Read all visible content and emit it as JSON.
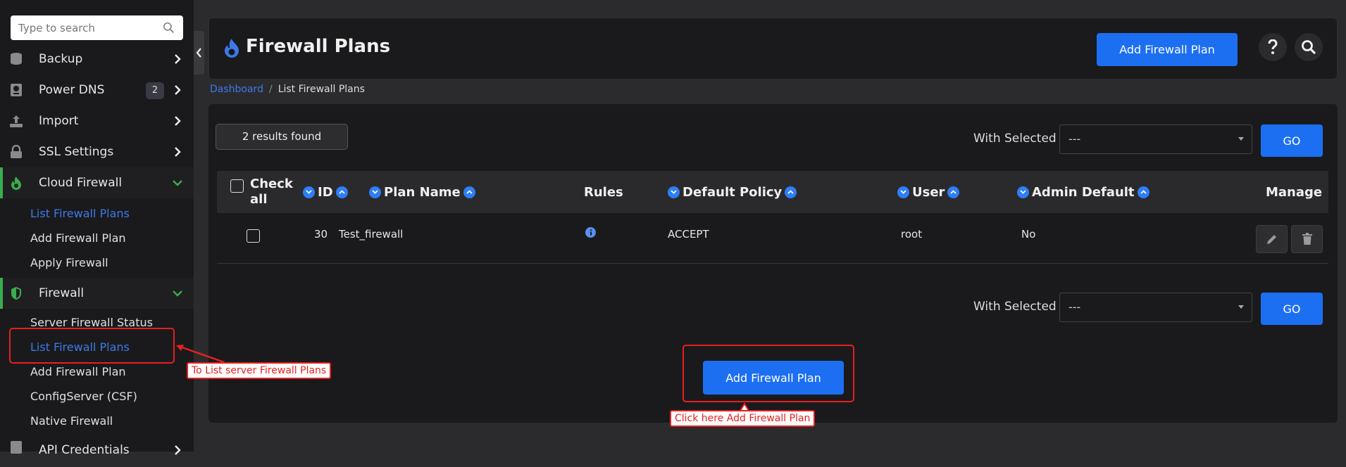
{
  "colors": {
    "accent": "#1d6ff2",
    "link": "#3d79e8",
    "active_bar": "#3aad4e",
    "annotation": "#e81f1f"
  },
  "sidebar": {
    "search_placeholder": "Type to search",
    "items": [
      {
        "label": "Backup",
        "icon": "database-icon"
      },
      {
        "label": "Power DNS",
        "icon": "dns-icon",
        "badge": "2"
      },
      {
        "label": "Import",
        "icon": "upload-icon"
      },
      {
        "label": "SSL Settings",
        "icon": "lock-icon"
      },
      {
        "label": "Cloud Firewall",
        "icon": "flame-icon"
      },
      {
        "label": "Firewall",
        "icon": "shield-icon"
      },
      {
        "label": "API Credentials",
        "icon": "key-icon"
      }
    ],
    "cloud_firewall_sub": [
      "List Firewall Plans",
      "Add Firewall Plan",
      "Apply Firewall"
    ],
    "firewall_sub": [
      "Server Firewall Status",
      "List Firewall Plans",
      "Add Firewall Plan",
      "ConfigServer (CSF)",
      "Native Firewall"
    ]
  },
  "header": {
    "title": "Firewall Plans",
    "add_button": "Add Firewall Plan"
  },
  "breadcrumb": {
    "home": "Dashboard",
    "separator": "/",
    "current": "List Firewall Plans"
  },
  "content": {
    "results": "2 results found",
    "with_selected": "With Selected",
    "select_value": "---",
    "go": "GO",
    "columns": {
      "check_all": "Check all",
      "id": "ID",
      "plan_name": "Plan Name",
      "rules": "Rules",
      "default_policy": "Default Policy",
      "user": "User",
      "admin_default": "Admin Default",
      "manage": "Manage"
    },
    "rows": [
      {
        "id": "30",
        "plan_name": "Test_firewall",
        "default_policy": "ACCEPT",
        "user": "root",
        "admin_default": "No"
      }
    ],
    "bottom_add": "Add Firewall Plan"
  },
  "annotations": {
    "list_plans": "To List server Firewall Plans",
    "add_plan": "Click here Add Firewall Plan"
  }
}
